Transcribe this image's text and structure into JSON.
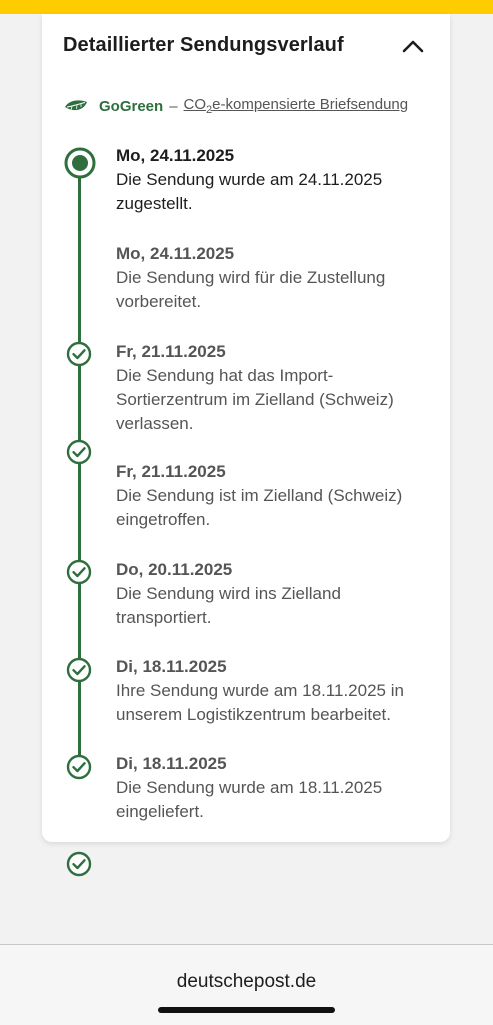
{
  "colors": {
    "brand_yellow": "#ffcc00",
    "gogreen": "#2f6f3e",
    "text_dark": "#1d1d1d",
    "text_muted": "#555555"
  },
  "card": {
    "title": "Detaillierter Sendungsverlauf",
    "collapse_icon": "chevron-up-icon"
  },
  "gogreen": {
    "icon": "leaf-icon",
    "brand": "GoGreen",
    "separator": "–",
    "link_pre": "CO",
    "link_sub": "2",
    "link_post": "e-kompensierte Briefsendung"
  },
  "events": [
    {
      "date": "Mo, 24.11.2025",
      "lines": [
        "Die Sendung wurde am 24.11.2025",
        "zugestellt."
      ],
      "status": "current"
    },
    {
      "date": "Mo, 24.11.2025",
      "lines": [
        "Die Sendung wird für die Zustellung",
        "vorbereitet."
      ],
      "status": "done"
    },
    {
      "date": "Fr, 21.11.2025",
      "lines": [
        "Die Sendung hat das Import-",
        "Sortierzentrum im Zielland (Schweiz)",
        "verlassen."
      ],
      "status": "done"
    },
    {
      "date": "Fr, 21.11.2025",
      "lines": [
        "Die Sendung ist im Zielland (Schweiz)",
        "eingetroffen."
      ],
      "status": "done"
    },
    {
      "date": "Do, 20.11.2025",
      "lines": [
        "Die Sendung wird ins Zielland",
        "transportiert."
      ],
      "status": "done"
    },
    {
      "date": "Di, 18.11.2025",
      "lines": [
        "Ihre Sendung wurde am 18.11.2025 in",
        "unserem Logistikzentrum bearbeitet."
      ],
      "status": "done"
    },
    {
      "date": "Di, 18.11.2025",
      "lines": [
        "Die Sendung wurde am 18.11.2025",
        "eingeliefert."
      ],
      "status": "done"
    }
  ],
  "footer": {
    "url": "deutschepost.de"
  }
}
